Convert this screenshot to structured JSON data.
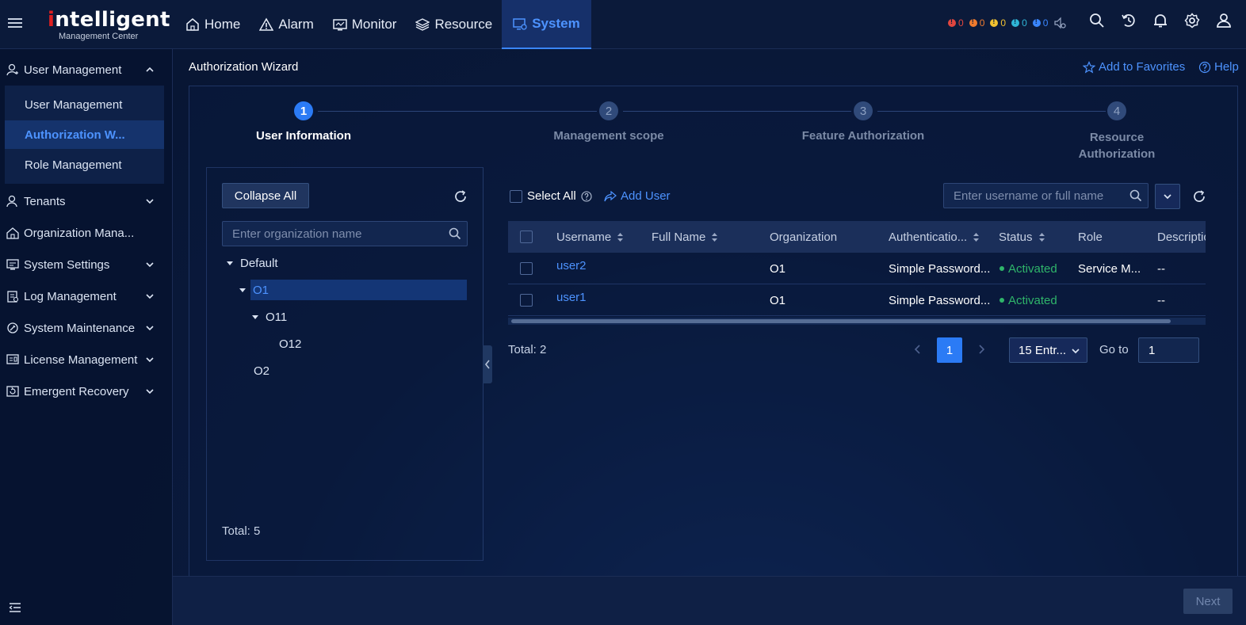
{
  "header": {
    "logo_main_rest": "ntelligent",
    "logo_main_i": "i",
    "logo_sub": "Management Center",
    "nav": [
      {
        "label": "Home",
        "icon": "home-icon"
      },
      {
        "label": "Alarm",
        "icon": "warning-icon"
      },
      {
        "label": "Monitor",
        "icon": "monitor-icon"
      },
      {
        "label": "Resource",
        "icon": "layers-icon"
      },
      {
        "label": "System",
        "icon": "system-icon",
        "active": true
      }
    ],
    "alarm_counts": [
      {
        "color": "#e2463f",
        "count": "0"
      },
      {
        "color": "#f07b2e",
        "count": "0"
      },
      {
        "color": "#f2c230",
        "count": "0"
      },
      {
        "color": "#2fb5d6",
        "count": "0"
      },
      {
        "color": "#3a86ff",
        "count": "0"
      }
    ]
  },
  "sidebar": {
    "groups": [
      {
        "label": "User Management",
        "icon": "user-icon",
        "expanded": true,
        "items": [
          {
            "label": "User Management"
          },
          {
            "label": "Authorization W...",
            "active": true
          },
          {
            "label": "Role Management"
          }
        ]
      },
      {
        "label": "Tenants",
        "icon": "tenant-icon"
      },
      {
        "label": "Organization Mana...",
        "icon": "org-icon"
      },
      {
        "label": "System Settings",
        "icon": "settings-icon"
      },
      {
        "label": "Log Management",
        "icon": "log-icon"
      },
      {
        "label": "System Maintenance",
        "icon": "maintenance-icon"
      },
      {
        "label": "License Management",
        "icon": "license-icon"
      },
      {
        "label": "Emergent Recovery",
        "icon": "recovery-icon"
      }
    ]
  },
  "page": {
    "title": "Authorization Wizard",
    "favorites_label": "Add to Favorites",
    "help_label": "Help"
  },
  "wizard": {
    "steps": [
      {
        "num": "1",
        "label": "User Information",
        "active": true
      },
      {
        "num": "2",
        "label": "Management scope"
      },
      {
        "num": "3",
        "label": "Feature Authorization"
      },
      {
        "num": "4",
        "label_line1": "Resource",
        "label_line2": "Authorization"
      }
    ]
  },
  "org_tree": {
    "collapse_label": "Collapse All",
    "search_placeholder": "Enter organization name",
    "nodes": [
      {
        "label": "Default",
        "level": 0,
        "expanded": true
      },
      {
        "label": "O1",
        "level": 1,
        "expanded": true,
        "selected": true
      },
      {
        "label": "O11",
        "level": 2,
        "expanded": true
      },
      {
        "label": "O12",
        "level": 3
      },
      {
        "label": "O2",
        "level": 1
      }
    ],
    "total": "Total: 5"
  },
  "users": {
    "select_all_label": "Select All",
    "add_user_label": "Add User",
    "search_placeholder": "Enter username or full name",
    "columns": [
      "Username",
      "Full Name",
      "Organization",
      "Authenticatio...",
      "Status",
      "Role",
      "Descriptio"
    ],
    "rows": [
      {
        "username": "user2",
        "full_name": "",
        "organization": "O1",
        "auth": "Simple Password...",
        "status": "Activated",
        "role": "Service M...",
        "description": "--"
      },
      {
        "username": "user1",
        "full_name": "",
        "organization": "O1",
        "auth": "Simple Password...",
        "status": "Activated",
        "role": "",
        "description": "--"
      }
    ],
    "total": "Total: 2",
    "current_page": "1",
    "page_size": "15 Entr...",
    "goto_label": "Go to",
    "goto_value": "1"
  },
  "footer": {
    "next_label": "Next"
  }
}
